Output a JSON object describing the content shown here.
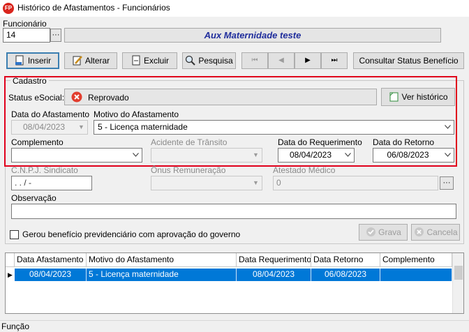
{
  "window": {
    "title": "Histórico de Afastamentos - Funcionários",
    "app_icon_text": "FP"
  },
  "funcionario": {
    "label": "Funcionário",
    "code": "14",
    "name": "Aux Maternidade teste"
  },
  "toolbar": {
    "inserir": "Inserir",
    "alterar": "Alterar",
    "excluir": "Excluir",
    "pesquisa": "Pesquisa",
    "nav_first": "⏮",
    "nav_prev": "◀",
    "nav_next": "▶",
    "nav_last": "⏭",
    "consultar": "Consultar Status Benefício"
  },
  "cadastro": {
    "legend": "Cadastro",
    "status_label": "Status eSocial:",
    "status_value": "Reprovado",
    "ver_historico": "Ver histórico",
    "data_afastamento_label": "Data do Afastamento",
    "data_afastamento_value": "08/04/2023",
    "motivo_label": "Motivo do Afastamento",
    "motivo_value": "5  -  Licença maternidade",
    "complemento_label": "Complemento",
    "complemento_value": "",
    "acidente_label": "Acidente de Trânsito",
    "data_requerimento_label": "Data do Requerimento",
    "data_requerimento_value": "08/04/2023",
    "data_retorno_label": "Data do Retorno",
    "data_retorno_value": "06/08/2023",
    "cnpj_label": "C.N.P.J. Sindicato",
    "cnpj_value": ".  .  /   -",
    "onus_label": "Ônus Remuneração",
    "atestado_label": "Atestado Médico",
    "atestado_value": "0",
    "observacao_label": "Observação",
    "observacao_value": "",
    "beneficio_label": "Gerou benefício previdenciário com aprovação do governo",
    "grava": "Grava",
    "cancela": "Cancela"
  },
  "grid": {
    "headers": [
      "Data Afastamento",
      "Motivo do Afastamento",
      "Data Requerimento",
      "Data Retorno",
      "Complemento"
    ],
    "rows": [
      [
        "08/04/2023",
        "5  -  Licença maternidade",
        "08/04/2023",
        "06/08/2023",
        ""
      ]
    ]
  },
  "statusbar": {
    "text": "Função"
  },
  "colors": {
    "selection": "#0078d7",
    "highlight_frame": "#e0001b",
    "employee_name": "#1f2d9c"
  }
}
